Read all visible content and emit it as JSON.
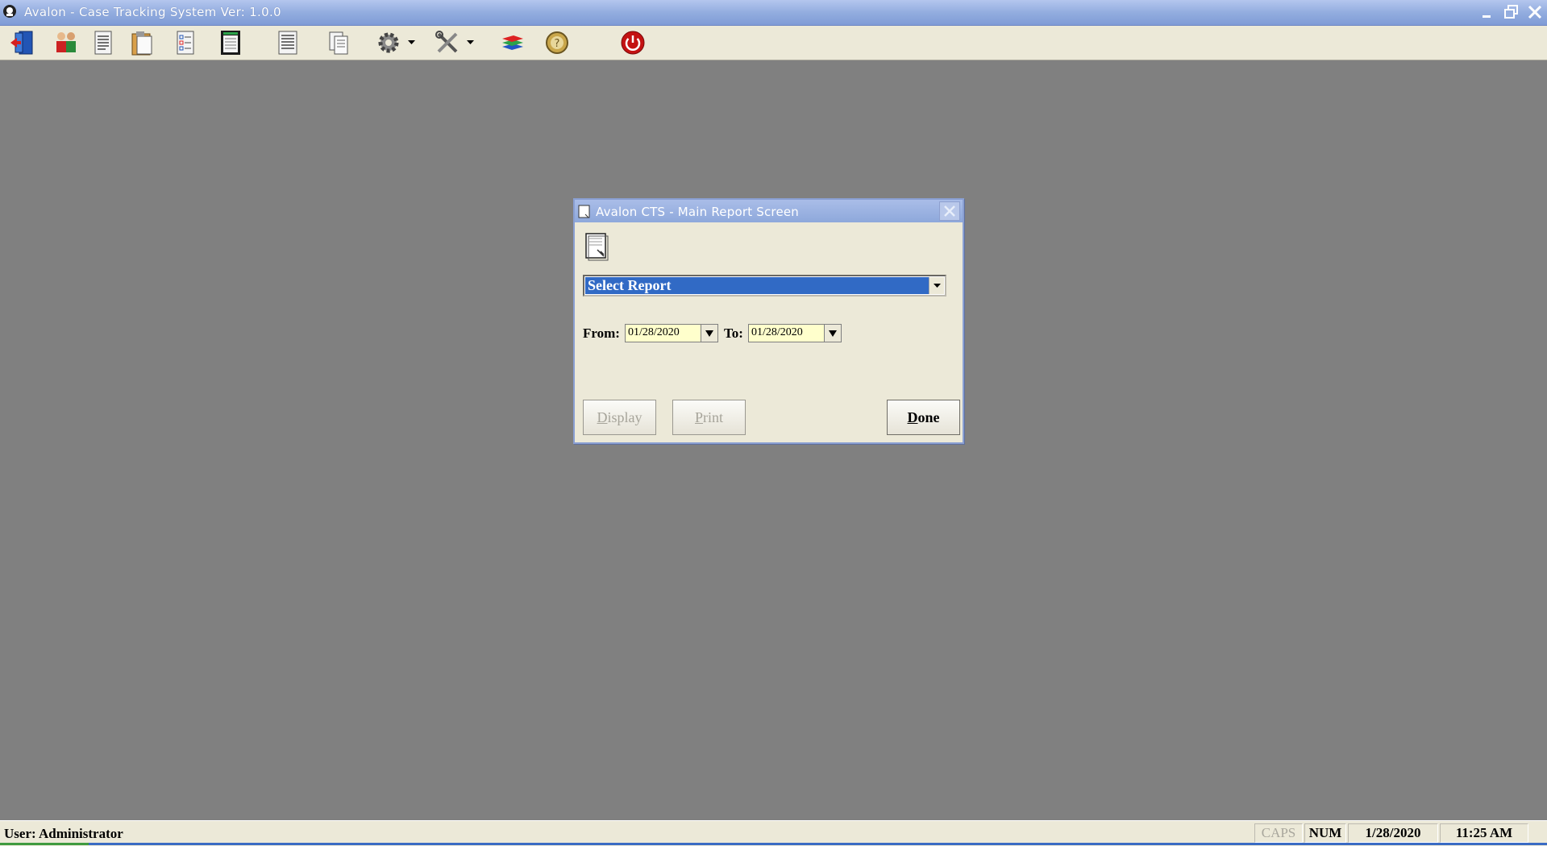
{
  "app": {
    "title": "Avalon - Case Tracking System   Ver: 1.0.0"
  },
  "toolbar": {
    "items": [
      {
        "icon": "exit-door-icon"
      },
      {
        "icon": "users-icon"
      },
      {
        "icon": "document-icon"
      },
      {
        "icon": "clipboard-icon"
      },
      {
        "icon": "checklist-icon"
      },
      {
        "icon": "notepad-icon"
      },
      {
        "icon": "list-icon"
      },
      {
        "icon": "copy-pages-icon"
      },
      {
        "icon": "gear-icon"
      },
      {
        "icon": "tools-icon"
      },
      {
        "icon": "stacked-layers-icon"
      },
      {
        "icon": "help-icon"
      },
      {
        "icon": "power-icon"
      }
    ]
  },
  "dialog": {
    "title": "Avalon CTS - Main Report Screen",
    "report_select": {
      "value": "Select Report"
    },
    "from_label": "From:",
    "from_value": "01/28/2020",
    "to_label": "To:",
    "to_value": "01/28/2020",
    "display_label": "Display",
    "print_label": "Print",
    "done_label": "Done"
  },
  "statusbar": {
    "user": "User: Administrator",
    "caps": "CAPS",
    "num": "NUM",
    "date": "1/28/2020",
    "time": "11:25 AM"
  },
  "colors": {
    "desktop": "#808080",
    "titlebar": "#93addf",
    "selection": "#316ac5",
    "date_field": "#ffffcc"
  }
}
